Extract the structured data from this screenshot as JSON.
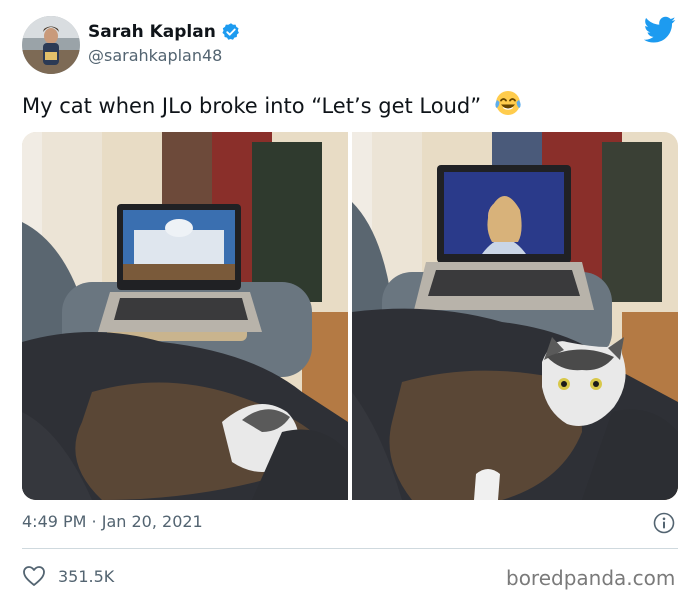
{
  "author": {
    "name": "Sarah Kaplan",
    "handle": "@sarahkaplan48",
    "verified": true
  },
  "tweet": {
    "text": "My cat when JLo broke into “Let’s get Loud”",
    "emoji": "face-with-tears-of-joy"
  },
  "photos": [
    {
      "subject": "cat sleeping on couch, laptop showing Capitol building"
    },
    {
      "subject": "cat wide awake on couch, laptop showing singer"
    }
  ],
  "meta": {
    "time": "4:49 PM · Jan 20, 2021"
  },
  "engagement": {
    "likes": "351.5K"
  },
  "watermark": "boredpanda.com",
  "colors": {
    "text": "#0f1419",
    "secondary": "#536471",
    "twitter_blue": "#1d9bf0",
    "divider": "#cfd9de"
  }
}
